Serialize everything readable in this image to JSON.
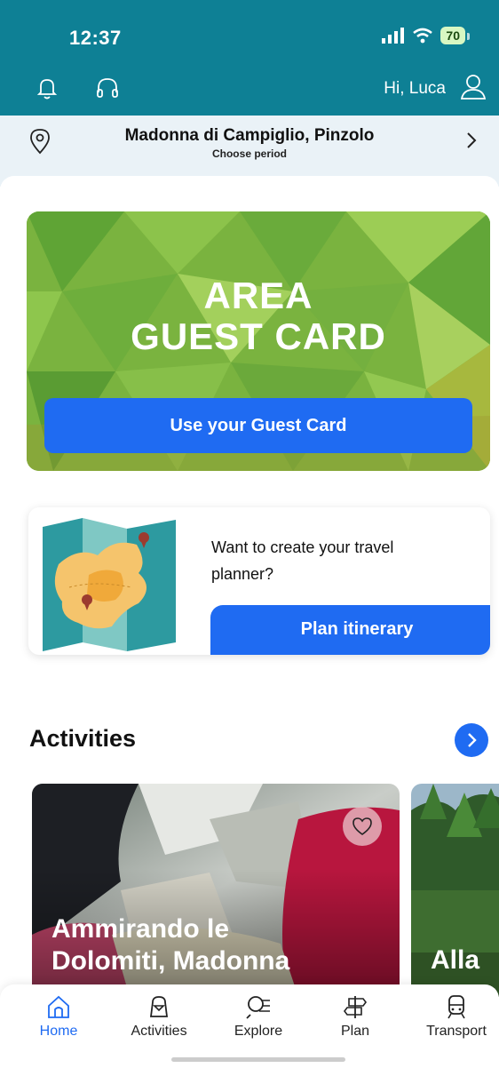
{
  "status": {
    "time": "12:37",
    "battery": "70"
  },
  "header": {
    "greeting": "Hi, Luca"
  },
  "location": {
    "name": "Madonna di Campiglio, Pinzolo",
    "subtitle": "Choose period"
  },
  "guest_card": {
    "title_line1": "AREA",
    "title_line2": "GUEST CARD",
    "button_label": "Use your Guest Card"
  },
  "planner": {
    "text": "Want to create your travel planner?",
    "button_label": "Plan itinerary"
  },
  "activities": {
    "title": "Activities",
    "items": [
      {
        "title_line1": "Ammirando le",
        "title_line2": "Dolomiti, Madonna"
      },
      {
        "title_line1": "Alla"
      }
    ]
  },
  "tabbar": {
    "items": [
      {
        "label": "Home",
        "icon": "home-icon",
        "active": true
      },
      {
        "label": "Activities",
        "icon": "backpack-icon",
        "active": false
      },
      {
        "label": "Explore",
        "icon": "explore-icon",
        "active": false
      },
      {
        "label": "Plan",
        "icon": "signpost-icon",
        "active": false
      },
      {
        "label": "Transport",
        "icon": "train-icon",
        "active": false
      }
    ]
  },
  "colors": {
    "header": "#0e8095",
    "accent": "#1f6bf2",
    "location_bar": "#eaf2f7"
  }
}
